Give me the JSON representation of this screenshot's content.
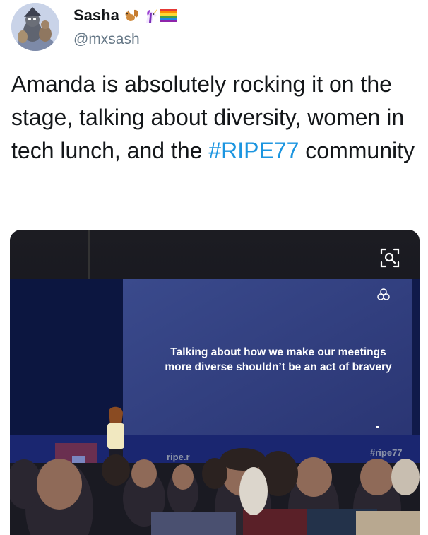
{
  "tweet": {
    "display_name": "Sasha",
    "name_emojis": [
      "squirrel-emoji",
      "unicorn-emoji",
      "rainbow-flag-emoji"
    ],
    "handle": "@mxsash",
    "text_before": "Amanda is absolutely rocking it on the stage, talking about diversity, women in tech lunch, and the ",
    "hashtag": "#RIPE77",
    "text_after": " community"
  },
  "media": {
    "slide_quote_line1": "Talking about how we make our meetings",
    "slide_quote_line2": "more diverse shouldn’t be an act of bravery",
    "banner_hashtag": "#ripe77",
    "banner_url": "ripe.r",
    "zoom_icon": "scan-zoom-icon"
  },
  "colors": {
    "hashtag": "#1b95e0",
    "handle": "#657786",
    "text": "#14171a"
  }
}
